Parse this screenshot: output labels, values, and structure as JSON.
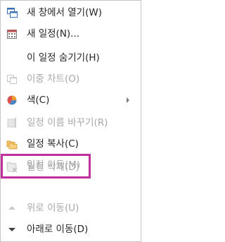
{
  "menu": {
    "items": [
      {
        "label": "새 창에서 열기(W)",
        "enabled": true,
        "icon": "new-window-icon"
      },
      {
        "label": "새 일정(N)...",
        "enabled": true,
        "icon": "new-calendar-icon"
      },
      {
        "label": "이 일정 숨기기(H)",
        "enabled": true,
        "icon": ""
      },
      {
        "label": "이중 차트(O)",
        "enabled": false,
        "icon": "overlay-chart-icon"
      },
      {
        "label": "색(C)",
        "enabled": true,
        "icon": "color-pie-icon",
        "submenu": true
      },
      {
        "label": "일정 이름 바꾸기(R)",
        "enabled": false,
        "icon": "rename-calendar-icon"
      },
      {
        "label": "일정 복사(C)",
        "enabled": true,
        "icon": "copy-folder-icon"
      },
      {
        "label": "일정 이동(M)",
        "enabled": false,
        "icon": "move-folder-icon"
      },
      {
        "label": "일정 삭제(D)",
        "enabled": false,
        "icon": "delete-calendar-icon"
      },
      {
        "label": "위로 이동(U)",
        "enabled": false,
        "icon": "move-up-icon"
      },
      {
        "label": "아래로 이동(D)",
        "enabled": true,
        "icon": "move-down-icon"
      }
    ]
  },
  "colors": {
    "text": "#262626",
    "disabled_text": "#a8a8a8",
    "highlight_border": "#c0309c"
  }
}
